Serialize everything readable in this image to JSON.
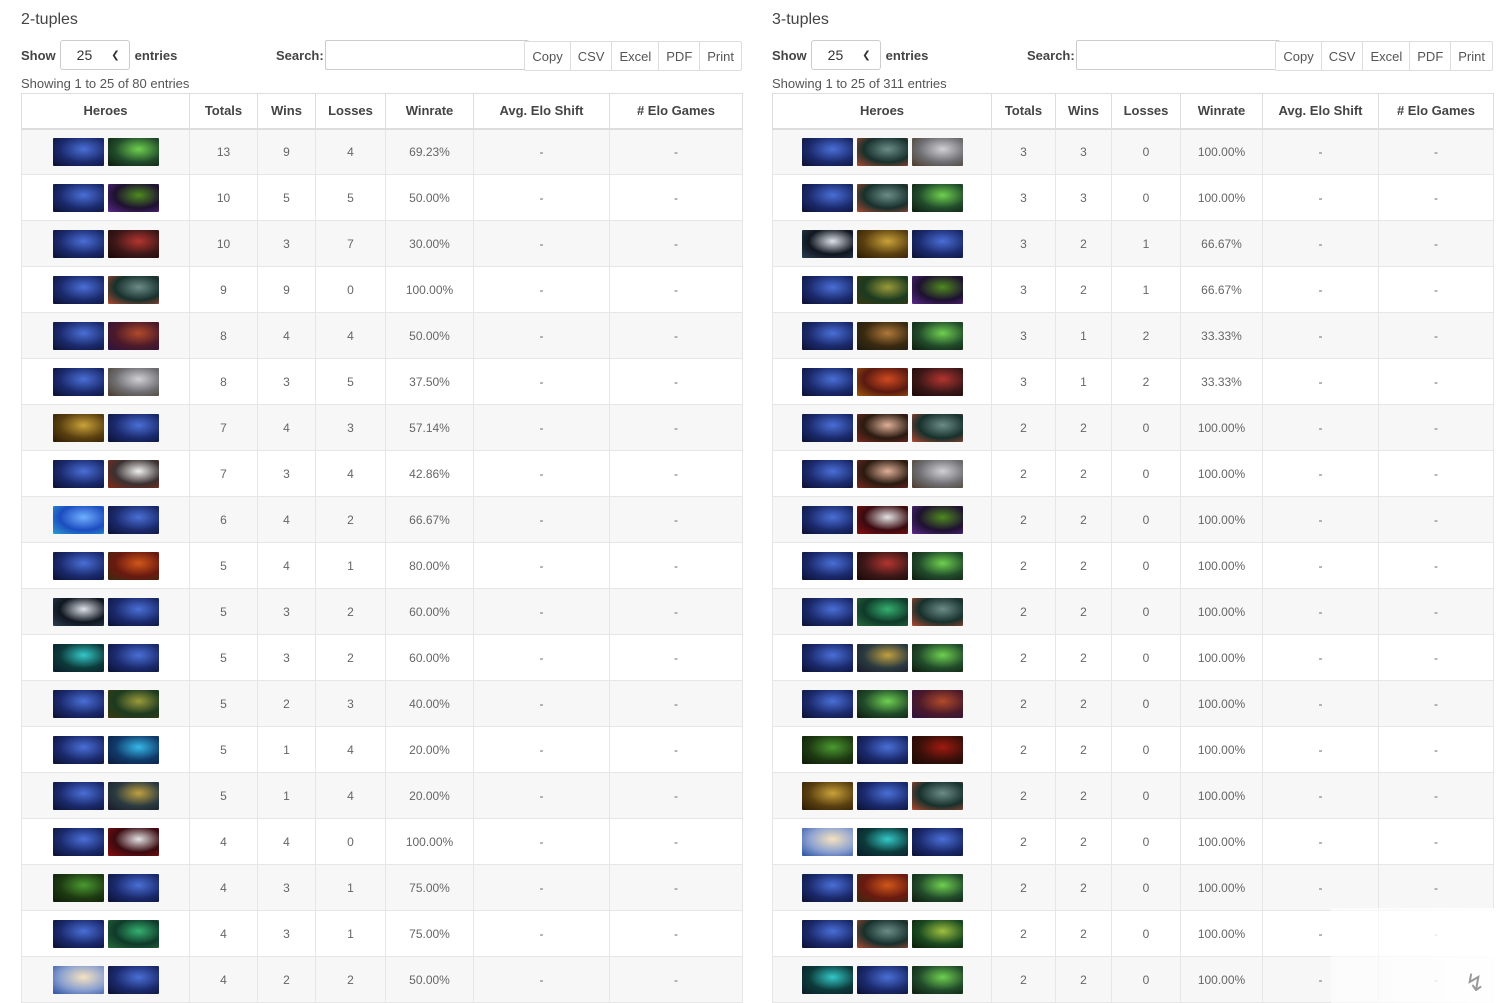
{
  "colors": {
    "hero_palette": {
      "riki": [
        "#1b2a6d",
        "#4a6fd6",
        "#0b1030"
      ],
      "rubick": [
        "#214b2b",
        "#6fd050",
        "#0d1a0c"
      ],
      "void": [
        "#1e1130",
        "#4d8a1f",
        "#5a2a8a"
      ],
      "lifestealer": [
        "#3d1818",
        "#b3352f",
        "#1a0707"
      ],
      "tusk": [
        "#17302c",
        "#6c8c88",
        "#b04a30"
      ],
      "bat": [
        "#4c1a2a",
        "#b14a2a",
        "#2c1240"
      ],
      "tiny": [
        "#6e6e72",
        "#d0d0d6",
        "#4a3a2a"
      ],
      "sand": [
        "#5a4010",
        "#caa23a",
        "#2a1a05"
      ],
      "pudge": [
        "#3a3030",
        "#f0f0f0",
        "#8a2a1a"
      ],
      "morph": [
        "#1c4cc0",
        "#6fb0ff",
        "#2aa0d0"
      ],
      "axe": [
        "#6a1a10",
        "#d0561a",
        "#3b2a10"
      ],
      "luna": [
        "#0f1620",
        "#dfe2ea",
        "#2b3e52"
      ],
      "puck": [
        "#0c3a3a",
        "#35c8c8",
        "#0a1a2a"
      ],
      "beast": [
        "#1c3a20",
        "#9a9a3a",
        "#3a3a10"
      ],
      "kotl": [
        "#103a6a",
        "#36b8e8",
        "#0c1a3a"
      ],
      "kunkka": [
        "#2a3a40",
        "#c0a040",
        "#1a1a2a"
      ],
      "qop": [
        "#3a0a10",
        "#e4e4e4",
        "#8a1010"
      ],
      "venom": [
        "#1e3a12",
        "#4a9a30",
        "#0c1a08"
      ],
      "medusa": [
        "#0f3a2a",
        "#35b070",
        "#2a6a3a"
      ],
      "cm": [
        "#8aa0d0",
        "#f6e2c0",
        "#2a50a0"
      ],
      "ember": [
        "#5a1a10",
        "#d04a20",
        "#a05a10"
      ],
      "invoker": [
        "#2a1a10",
        "#e0b098",
        "#7a2a20"
      ],
      "wk": [
        "#3a100a",
        "#a01a10",
        "#1a0a05"
      ],
      "necro": [
        "#1a4a20",
        "#a0c040",
        "#0a1a08"
      ],
      "hoodwink": [
        "#3a2a10",
        "#b0783a",
        "#1a1a10"
      ]
    }
  },
  "left": {
    "title": "2-tuples",
    "show_label": "Show",
    "show_value": "25",
    "entries_label": "entries",
    "search_label": "Search:",
    "search_value": "",
    "buttons": [
      "Copy",
      "CSV",
      "Excel",
      "PDF",
      "Print"
    ],
    "info": "Showing 1 to 25 of 80 entries",
    "headers": [
      "Heroes",
      "Totals",
      "Wins",
      "Losses",
      "Winrate",
      "Avg. Elo Shift",
      "# Elo Games"
    ],
    "rows": [
      {
        "heroes": [
          "riki",
          "rubick"
        ],
        "totals": "13",
        "wins": "9",
        "losses": "4",
        "winrate": "69.23%",
        "elo_shift": "-",
        "elo_games": "-"
      },
      {
        "heroes": [
          "riki",
          "void"
        ],
        "totals": "10",
        "wins": "5",
        "losses": "5",
        "winrate": "50.00%",
        "elo_shift": "-",
        "elo_games": "-"
      },
      {
        "heroes": [
          "riki",
          "lifestealer"
        ],
        "totals": "10",
        "wins": "3",
        "losses": "7",
        "winrate": "30.00%",
        "elo_shift": "-",
        "elo_games": "-"
      },
      {
        "heroes": [
          "riki",
          "tusk"
        ],
        "totals": "9",
        "wins": "9",
        "losses": "0",
        "winrate": "100.00%",
        "elo_shift": "-",
        "elo_games": "-"
      },
      {
        "heroes": [
          "riki",
          "bat"
        ],
        "totals": "8",
        "wins": "4",
        "losses": "4",
        "winrate": "50.00%",
        "elo_shift": "-",
        "elo_games": "-"
      },
      {
        "heroes": [
          "riki",
          "tiny"
        ],
        "totals": "8",
        "wins": "3",
        "losses": "5",
        "winrate": "37.50%",
        "elo_shift": "-",
        "elo_games": "-"
      },
      {
        "heroes": [
          "sand",
          "riki"
        ],
        "totals": "7",
        "wins": "4",
        "losses": "3",
        "winrate": "57.14%",
        "elo_shift": "-",
        "elo_games": "-"
      },
      {
        "heroes": [
          "riki",
          "pudge"
        ],
        "totals": "7",
        "wins": "3",
        "losses": "4",
        "winrate": "42.86%",
        "elo_shift": "-",
        "elo_games": "-"
      },
      {
        "heroes": [
          "morph",
          "riki"
        ],
        "totals": "6",
        "wins": "4",
        "losses": "2",
        "winrate": "66.67%",
        "elo_shift": "-",
        "elo_games": "-"
      },
      {
        "heroes": [
          "riki",
          "axe"
        ],
        "totals": "5",
        "wins": "4",
        "losses": "1",
        "winrate": "80.00%",
        "elo_shift": "-",
        "elo_games": "-"
      },
      {
        "heroes": [
          "luna",
          "riki"
        ],
        "totals": "5",
        "wins": "3",
        "losses": "2",
        "winrate": "60.00%",
        "elo_shift": "-",
        "elo_games": "-"
      },
      {
        "heroes": [
          "puck",
          "riki"
        ],
        "totals": "5",
        "wins": "3",
        "losses": "2",
        "winrate": "60.00%",
        "elo_shift": "-",
        "elo_games": "-"
      },
      {
        "heroes": [
          "riki",
          "beast"
        ],
        "totals": "5",
        "wins": "2",
        "losses": "3",
        "winrate": "40.00%",
        "elo_shift": "-",
        "elo_games": "-"
      },
      {
        "heroes": [
          "riki",
          "kotl"
        ],
        "totals": "5",
        "wins": "1",
        "losses": "4",
        "winrate": "20.00%",
        "elo_shift": "-",
        "elo_games": "-"
      },
      {
        "heroes": [
          "riki",
          "kunkka"
        ],
        "totals": "5",
        "wins": "1",
        "losses": "4",
        "winrate": "20.00%",
        "elo_shift": "-",
        "elo_games": "-"
      },
      {
        "heroes": [
          "riki",
          "qop"
        ],
        "totals": "4",
        "wins": "4",
        "losses": "0",
        "winrate": "100.00%",
        "elo_shift": "-",
        "elo_games": "-"
      },
      {
        "heroes": [
          "venom",
          "riki"
        ],
        "totals": "4",
        "wins": "3",
        "losses": "1",
        "winrate": "75.00%",
        "elo_shift": "-",
        "elo_games": "-"
      },
      {
        "heroes": [
          "riki",
          "medusa"
        ],
        "totals": "4",
        "wins": "3",
        "losses": "1",
        "winrate": "75.00%",
        "elo_shift": "-",
        "elo_games": "-"
      },
      {
        "heroes": [
          "cm",
          "riki"
        ],
        "totals": "4",
        "wins": "2",
        "losses": "2",
        "winrate": "50.00%",
        "elo_shift": "-",
        "elo_games": "-"
      }
    ]
  },
  "right": {
    "title": "3-tuples",
    "show_label": "Show",
    "show_value": "25",
    "entries_label": "entries",
    "search_label": "Search:",
    "search_value": "",
    "buttons": [
      "Copy",
      "CSV",
      "Excel",
      "PDF",
      "Print"
    ],
    "info": "Showing 1 to 25 of 311 entries",
    "headers": [
      "Heroes",
      "Totals",
      "Wins",
      "Losses",
      "Winrate",
      "Avg. Elo Shift",
      "# Elo Games"
    ],
    "rows": [
      {
        "heroes": [
          "riki",
          "tusk",
          "tiny"
        ],
        "totals": "3",
        "wins": "3",
        "losses": "0",
        "winrate": "100.00%",
        "elo_shift": "-",
        "elo_games": "-"
      },
      {
        "heroes": [
          "riki",
          "tusk",
          "rubick"
        ],
        "totals": "3",
        "wins": "3",
        "losses": "0",
        "winrate": "100.00%",
        "elo_shift": "-",
        "elo_games": "-"
      },
      {
        "heroes": [
          "luna",
          "sand",
          "riki"
        ],
        "totals": "3",
        "wins": "2",
        "losses": "1",
        "winrate": "66.67%",
        "elo_shift": "-",
        "elo_games": "-"
      },
      {
        "heroes": [
          "riki",
          "beast",
          "void"
        ],
        "totals": "3",
        "wins": "2",
        "losses": "1",
        "winrate": "66.67%",
        "elo_shift": "-",
        "elo_games": "-"
      },
      {
        "heroes": [
          "riki",
          "hoodwink",
          "rubick"
        ],
        "totals": "3",
        "wins": "1",
        "losses": "2",
        "winrate": "33.33%",
        "elo_shift": "-",
        "elo_games": "-"
      },
      {
        "heroes": [
          "riki",
          "ember",
          "lifestealer"
        ],
        "totals": "3",
        "wins": "1",
        "losses": "2",
        "winrate": "33.33%",
        "elo_shift": "-",
        "elo_games": "-"
      },
      {
        "heroes": [
          "riki",
          "invoker",
          "tusk"
        ],
        "totals": "2",
        "wins": "2",
        "losses": "0",
        "winrate": "100.00%",
        "elo_shift": "-",
        "elo_games": "-"
      },
      {
        "heroes": [
          "riki",
          "invoker",
          "tiny"
        ],
        "totals": "2",
        "wins": "2",
        "losses": "0",
        "winrate": "100.00%",
        "elo_shift": "-",
        "elo_games": "-"
      },
      {
        "heroes": [
          "riki",
          "qop",
          "void"
        ],
        "totals": "2",
        "wins": "2",
        "losses": "0",
        "winrate": "100.00%",
        "elo_shift": "-",
        "elo_games": "-"
      },
      {
        "heroes": [
          "riki",
          "lifestealer",
          "rubick"
        ],
        "totals": "2",
        "wins": "2",
        "losses": "0",
        "winrate": "100.00%",
        "elo_shift": "-",
        "elo_games": "-"
      },
      {
        "heroes": [
          "riki",
          "medusa",
          "tusk"
        ],
        "totals": "2",
        "wins": "2",
        "losses": "0",
        "winrate": "100.00%",
        "elo_shift": "-",
        "elo_games": "-"
      },
      {
        "heroes": [
          "riki",
          "kunkka",
          "rubick"
        ],
        "totals": "2",
        "wins": "2",
        "losses": "0",
        "winrate": "100.00%",
        "elo_shift": "-",
        "elo_games": "-"
      },
      {
        "heroes": [
          "riki",
          "rubick",
          "bat"
        ],
        "totals": "2",
        "wins": "2",
        "losses": "0",
        "winrate": "100.00%",
        "elo_shift": "-",
        "elo_games": "-"
      },
      {
        "heroes": [
          "venom",
          "riki",
          "wk"
        ],
        "totals": "2",
        "wins": "2",
        "losses": "0",
        "winrate": "100.00%",
        "elo_shift": "-",
        "elo_games": "-"
      },
      {
        "heroes": [
          "sand",
          "riki",
          "tusk"
        ],
        "totals": "2",
        "wins": "2",
        "losses": "0",
        "winrate": "100.00%",
        "elo_shift": "-",
        "elo_games": "-"
      },
      {
        "heroes": [
          "cm",
          "puck",
          "riki"
        ],
        "totals": "2",
        "wins": "2",
        "losses": "0",
        "winrate": "100.00%",
        "elo_shift": "-",
        "elo_games": "-"
      },
      {
        "heroes": [
          "riki",
          "axe",
          "rubick"
        ],
        "totals": "2",
        "wins": "2",
        "losses": "0",
        "winrate": "100.00%",
        "elo_shift": "-",
        "elo_games": "-"
      },
      {
        "heroes": [
          "riki",
          "tusk",
          "necro"
        ],
        "totals": "2",
        "wins": "2",
        "losses": "0",
        "winrate": "100.00%",
        "elo_shift": "-",
        "elo_games": "-"
      },
      {
        "heroes": [
          "puck",
          "riki",
          "rubick"
        ],
        "totals": "2",
        "wins": "2",
        "losses": "0",
        "winrate": "100.00%",
        "elo_shift": "-",
        "elo_games": "-"
      }
    ]
  }
}
